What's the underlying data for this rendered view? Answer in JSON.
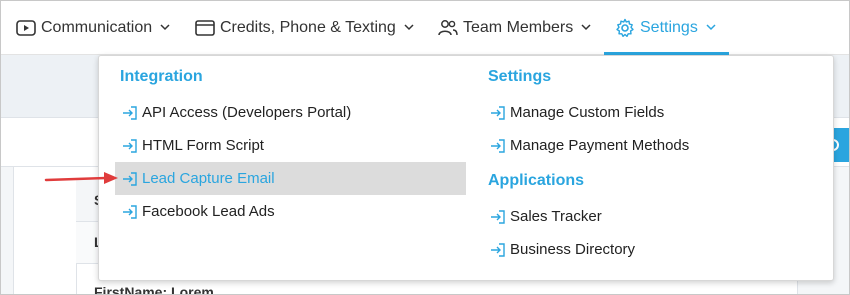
{
  "nav": {
    "items": [
      {
        "label": "Communication",
        "icon": "play-square-icon"
      },
      {
        "label": "Credits, Phone & Texting",
        "icon": "card-icon"
      },
      {
        "label": "Team Members",
        "icon": "users-icon"
      },
      {
        "label": "Settings",
        "icon": "gear-icon",
        "active": true
      }
    ]
  },
  "dropdown": {
    "integration": {
      "heading": "Integration",
      "items": [
        "API Access (Developers Portal)",
        "HTML Form Script",
        "Lead Capture Email",
        "Facebook Lead Ads"
      ],
      "highlighted_index": 2
    },
    "settings": {
      "heading": "Settings",
      "items": [
        "Manage Custom Fields",
        "Manage Payment Methods"
      ]
    },
    "applications": {
      "heading": "Applications",
      "items": [
        "Sales Tracker",
        "Business Directory"
      ]
    }
  },
  "background": {
    "header_fragment": "S",
    "row_fragment": "L",
    "bottom_fragment": "FirstName: Lorem"
  },
  "colors": {
    "accent": "#2aa5df",
    "annotation_arrow": "#e03c3c",
    "highlight_bg": "#dcdcdc"
  }
}
